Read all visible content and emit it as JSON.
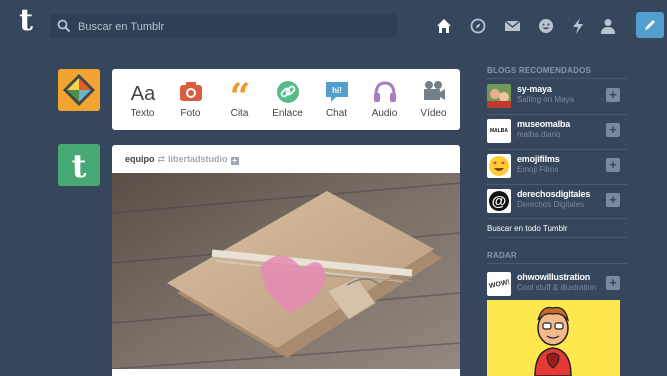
{
  "header": {
    "logo": "t",
    "search_placeholder": "Buscar en Tumblr",
    "nav_icons": [
      "home-icon",
      "explore-icon",
      "mail-icon",
      "activity-icon",
      "lightning-icon",
      "account-icon"
    ],
    "compose_icon": "pencil-icon"
  },
  "post_types": [
    {
      "label": "Texto",
      "icon": "text-icon",
      "color": "#444444"
    },
    {
      "label": "Foto",
      "icon": "camera-icon",
      "color": "#d95e40"
    },
    {
      "label": "Cita",
      "icon": "quote-icon",
      "color": "#f2992e"
    },
    {
      "label": "Enlace",
      "icon": "link-icon",
      "color": "#56bc8a"
    },
    {
      "label": "Chat",
      "icon": "chat-icon",
      "color": "#529ecc"
    },
    {
      "label": "Audio",
      "icon": "headphones-icon",
      "color": "#a77dc2"
    },
    {
      "label": "Vídeo",
      "icon": "video-camera-icon",
      "color": "#748089"
    }
  ],
  "post": {
    "author": "equipo",
    "source": "libertadstudio"
  },
  "sidebar": {
    "recommended_title": "BLOGS RECOMENDADOS",
    "blogs": [
      {
        "name": "sy-maya",
        "subtitle": "Sailing on Maya"
      },
      {
        "name": "museomalba",
        "subtitle": "malba.diario",
        "avatar_text": "MALBA"
      },
      {
        "name": "emojifilms",
        "subtitle": "Emoji Films"
      },
      {
        "name": "derechosdigitales",
        "subtitle": "Derechos Digitales"
      }
    ],
    "search_all": "Buscar en todo Tumblr",
    "radar_title": "RADAR",
    "radar_blog": {
      "name": "ohwowillustration",
      "subtitle": "Cool stuff & illustration",
      "avatar_text": "WOW!"
    }
  },
  "colors": {
    "background": "#36465d",
    "accent": "#529ecc"
  }
}
